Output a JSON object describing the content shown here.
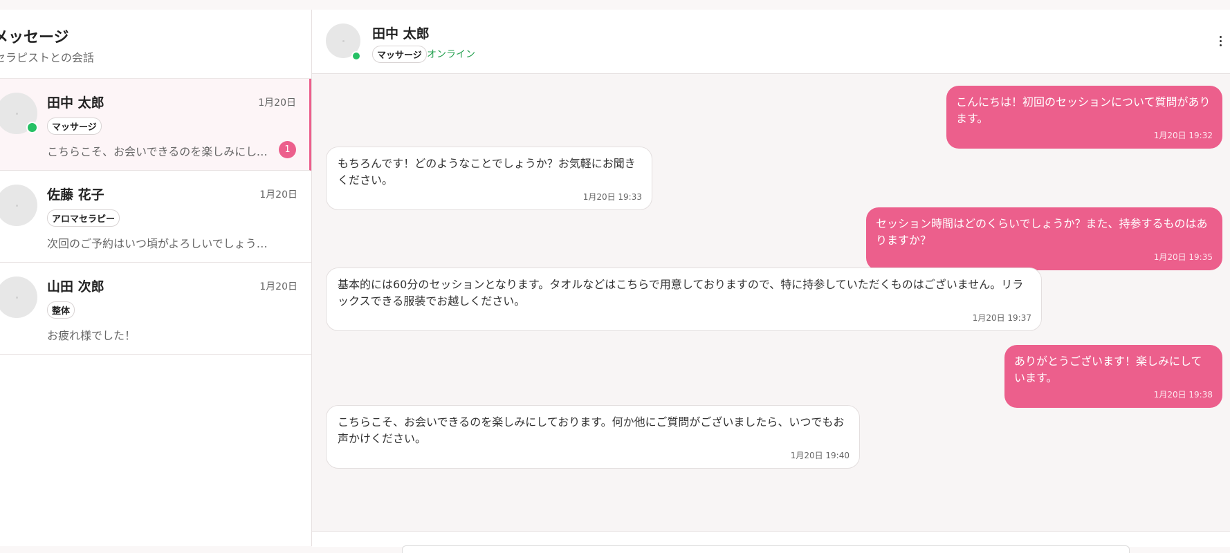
{
  "sidebar": {
    "title": "メッセージ",
    "subtitle": "セラピストとの会話",
    "conversations": [
      {
        "name": "田中 太郎",
        "date": "1月20日",
        "tag": "マッサージ",
        "preview": "こちらこそ、お会いできるのを楽しみにしております。何か他にご質問がございましたら、いつでもお声かけください。",
        "unread": "1",
        "online": true,
        "active": true
      },
      {
        "name": "佐藤 花子",
        "date": "1月20日",
        "tag": "アロマセラピー",
        "preview": "次回のご予約はいつ頃がよろしいでしょうか？",
        "online": false,
        "active": false
      },
      {
        "name": "山田 次郎",
        "date": "1月20日",
        "tag": "整体",
        "preview": "お疲れ様でした！",
        "online": false,
        "active": false
      }
    ]
  },
  "chat": {
    "name": "田中 太郎",
    "tag": "マッサージ",
    "status": "オンライン",
    "messages": [
      {
        "side": "sent",
        "text": "こんにちは！初回のセッションについて質問があります。",
        "time": "1月20日 19:32"
      },
      {
        "side": "recv",
        "text": "もちろんです！どのようなことでしょうか？お気軽にお聞きください。",
        "time": "1月20日 19:33"
      },
      {
        "side": "sent",
        "text": "セッション時間はどのくらいでしょうか？また、持参するものはありますか？",
        "time": "1月20日 19:35"
      },
      {
        "side": "recv",
        "text": "基本的には60分のセッションとなります。タオルなどはこちらで用意しておりますので、特に持参していただくものはございません。リラックスできる服装でお越しください。",
        "time": "1月20日 19:37"
      },
      {
        "side": "sent",
        "text": "ありがとうございます！楽しみにしています。",
        "time": "1月20日 19:38"
      },
      {
        "side": "recv",
        "text": "こちらこそ、お会いできるのを楽しみにしております。何か他にご質問がございましたら、いつでもお声かけください。",
        "time": "1月20日 19:40"
      }
    ]
  },
  "colors": {
    "accent": "#ec5f8c",
    "online": "#25c064"
  },
  "icons": {
    "menu": "more-vertical-icon",
    "avatar": "avatar-placeholder-icon"
  }
}
